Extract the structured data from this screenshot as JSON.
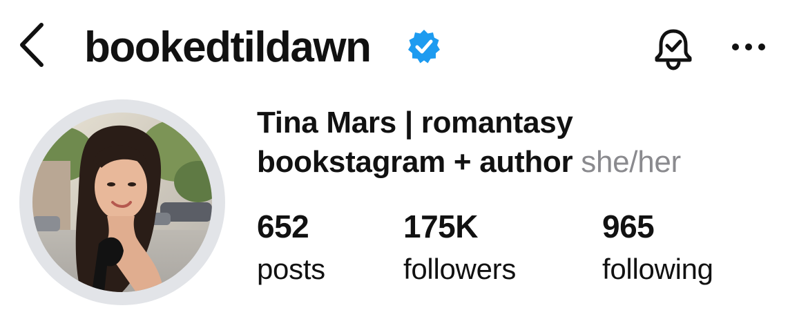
{
  "header": {
    "username": "bookedtildawn",
    "verified": true,
    "accent_color": "#1d9bf0"
  },
  "icons": {
    "back": "chevron-left-icon",
    "verified": "verified-badge-icon",
    "notifications": "bell-check-icon",
    "more": "more-horizontal-icon"
  },
  "profile": {
    "full_name": "Tina Mars | romantasy",
    "bio": "bookstagram + author",
    "pronouns": "she/her"
  },
  "stats": [
    {
      "value": "652",
      "label": "posts"
    },
    {
      "value": "175K",
      "label": "followers"
    },
    {
      "value": "965",
      "label": "following"
    }
  ]
}
